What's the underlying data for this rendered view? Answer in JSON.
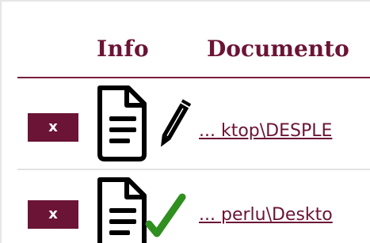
{
  "table": {
    "headers": {
      "info": "Info",
      "documento": "Documento"
    },
    "rows": [
      {
        "delete_label": "x",
        "info_icon": "document-edit-icon",
        "document_link": "... ktop\\DESPLE"
      },
      {
        "delete_label": "x",
        "info_icon": "document-check-icon",
        "document_link": "... perlu\\Deskto"
      }
    ]
  },
  "colors": {
    "accent": "#6b1436",
    "check": "#2f8f1f",
    "icon_stroke": "#000000"
  }
}
